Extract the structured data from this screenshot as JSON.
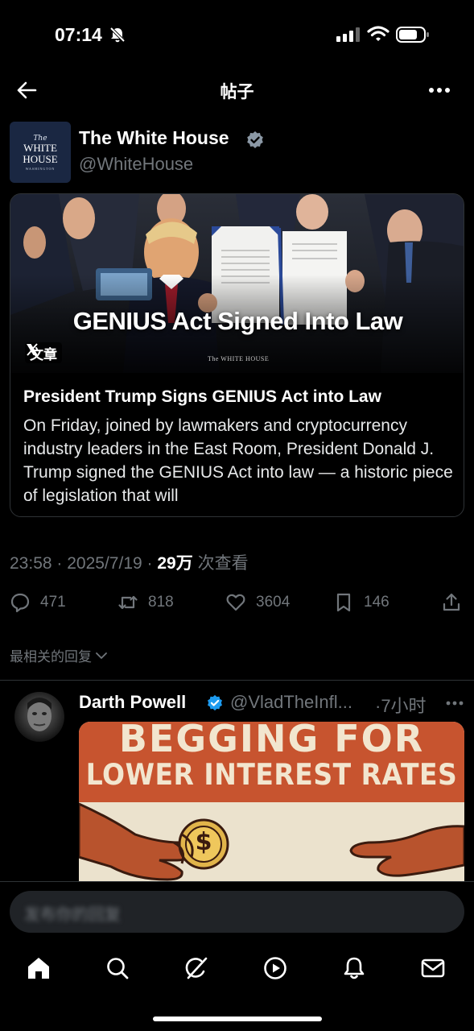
{
  "status_bar": {
    "time": "07:14"
  },
  "nav": {
    "title": "帖子"
  },
  "post": {
    "author": {
      "avatar_the": "The",
      "avatar_line1": "WHITE",
      "avatar_line2": "HOUSE",
      "avatar_line3": "WASHINGTON",
      "name": "The White House",
      "handle": "@WhiteHouse",
      "verified": true
    },
    "article": {
      "image_headline": "GENIUS Act Signed Into Law",
      "tag_label": "文章",
      "watermark": "The WHITE HOUSE",
      "title": "President Trump Signs GENIUS Act into Law",
      "body": "On Friday, joined by lawmakers and cryptocurrency industry leaders in the East Room, President Donald J. Trump signed the GENIUS Act into law — a historic piece of legislation that will"
    },
    "meta": {
      "time": "23:58",
      "date": "2025/7/19",
      "views_count": "29万",
      "views_label": "次查看",
      "separator": "·"
    },
    "actions": {
      "replies": "471",
      "reposts": "818",
      "likes": "3604",
      "bookmarks": "146"
    }
  },
  "replies_sort": {
    "label": "最相关的回复"
  },
  "reply": {
    "name": "Darth Powell",
    "handle": "@VladTheInfl...",
    "time": "·7小时",
    "image_text_line1": "BEGGING FOR",
    "image_text_line2": "LOWER INTEREST RATES",
    "image_coin_symbol": "$"
  },
  "composer": {
    "placeholder": "发布你的回复"
  },
  "tabbar": {
    "items": [
      "home",
      "search",
      "grok",
      "video",
      "notifications",
      "messages"
    ]
  },
  "colors": {
    "background": "#000000",
    "text_primary": "#e7e9ea",
    "text_secondary": "#71767b",
    "verified_blue": "#1d9bf0",
    "border": "#2f3336"
  }
}
